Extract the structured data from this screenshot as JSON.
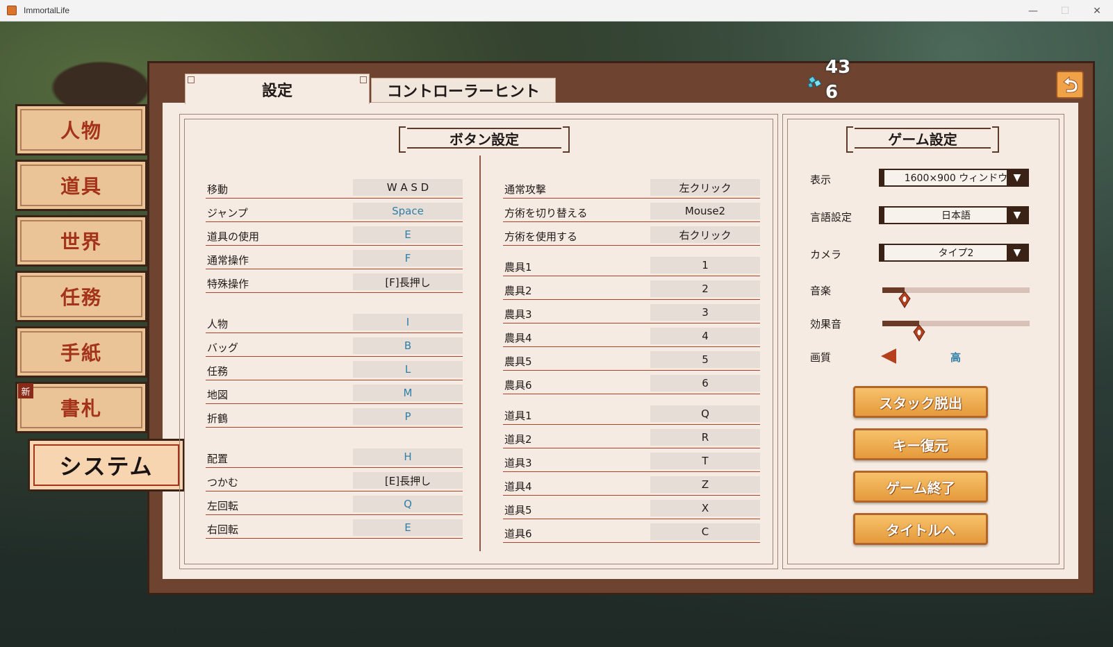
{
  "window": {
    "title": "ImmortalLife",
    "minimize": "—",
    "maximize": "☐",
    "close": "✕"
  },
  "tabs": [
    {
      "label": "設定"
    },
    {
      "label": "コントローラーヒント"
    }
  ],
  "currency": {
    "gems": "43",
    "second": "6"
  },
  "sidebar": {
    "items": [
      {
        "label": "人物"
      },
      {
        "label": "道具"
      },
      {
        "label": "世界"
      },
      {
        "label": "任務"
      },
      {
        "label": "手紙"
      },
      {
        "label": "書札",
        "badge": "新"
      }
    ],
    "active": {
      "label": "システム"
    }
  },
  "button_settings": {
    "title": "ボタン設定",
    "left": [
      {
        "label": "移動",
        "key": "W A S D"
      },
      {
        "label": "ジャンプ",
        "key": "Space"
      },
      {
        "label": "道具の使用",
        "key": "E"
      },
      {
        "label": "通常操作",
        "key": "F"
      },
      {
        "label": "特殊操作",
        "key": "[F]長押し"
      },
      {
        "label": "人物",
        "key": "I"
      },
      {
        "label": "バッグ",
        "key": "B"
      },
      {
        "label": "任務",
        "key": "L"
      },
      {
        "label": "地図",
        "key": "M"
      },
      {
        "label": "折鶴",
        "key": "P"
      },
      {
        "label": "配置",
        "key": "H"
      },
      {
        "label": "つかむ",
        "key": "[E]長押し"
      },
      {
        "label": "左回転",
        "key": "Q"
      },
      {
        "label": "右回転",
        "key": "E"
      }
    ],
    "right": [
      {
        "label": "通常攻撃",
        "key": "左クリック"
      },
      {
        "label": "方術を切り替える",
        "key": "Mouse2"
      },
      {
        "label": "方術を使用する",
        "key": "右クリック"
      },
      {
        "label": "農具1",
        "key": "1"
      },
      {
        "label": "農具2",
        "key": "2"
      },
      {
        "label": "農具3",
        "key": "3"
      },
      {
        "label": "農具4",
        "key": "4"
      },
      {
        "label": "農具5",
        "key": "5"
      },
      {
        "label": "農具6",
        "key": "6"
      },
      {
        "label": "道具1",
        "key": "Q"
      },
      {
        "label": "道具2",
        "key": "R"
      },
      {
        "label": "道具3",
        "key": "T"
      },
      {
        "label": "道具4",
        "key": "Z"
      },
      {
        "label": "道具5",
        "key": "X"
      },
      {
        "label": "道具6",
        "key": "C"
      }
    ]
  },
  "game_settings": {
    "title": "ゲーム設定",
    "display": {
      "label": "表示",
      "value": "1600×900 ウィンドウ"
    },
    "language": {
      "label": "言語設定",
      "value": "日本語"
    },
    "camera": {
      "label": "カメラ",
      "value": "タイプ2"
    },
    "music": {
      "label": "音楽",
      "level": 0.15
    },
    "sfx": {
      "label": "効果音",
      "level": 0.25
    },
    "quality": {
      "label": "画質",
      "value": "高"
    },
    "buttons": [
      {
        "label": "スタック脱出"
      },
      {
        "label": "キー復元"
      },
      {
        "label": "ゲーム終了"
      },
      {
        "label": "タイトルへ"
      }
    ]
  },
  "colors": {
    "accent_red": "#a3331a",
    "key_blue": "#2f7fa8",
    "panel_brown": "#6e4430",
    "button_orange": "#e59a3c"
  }
}
